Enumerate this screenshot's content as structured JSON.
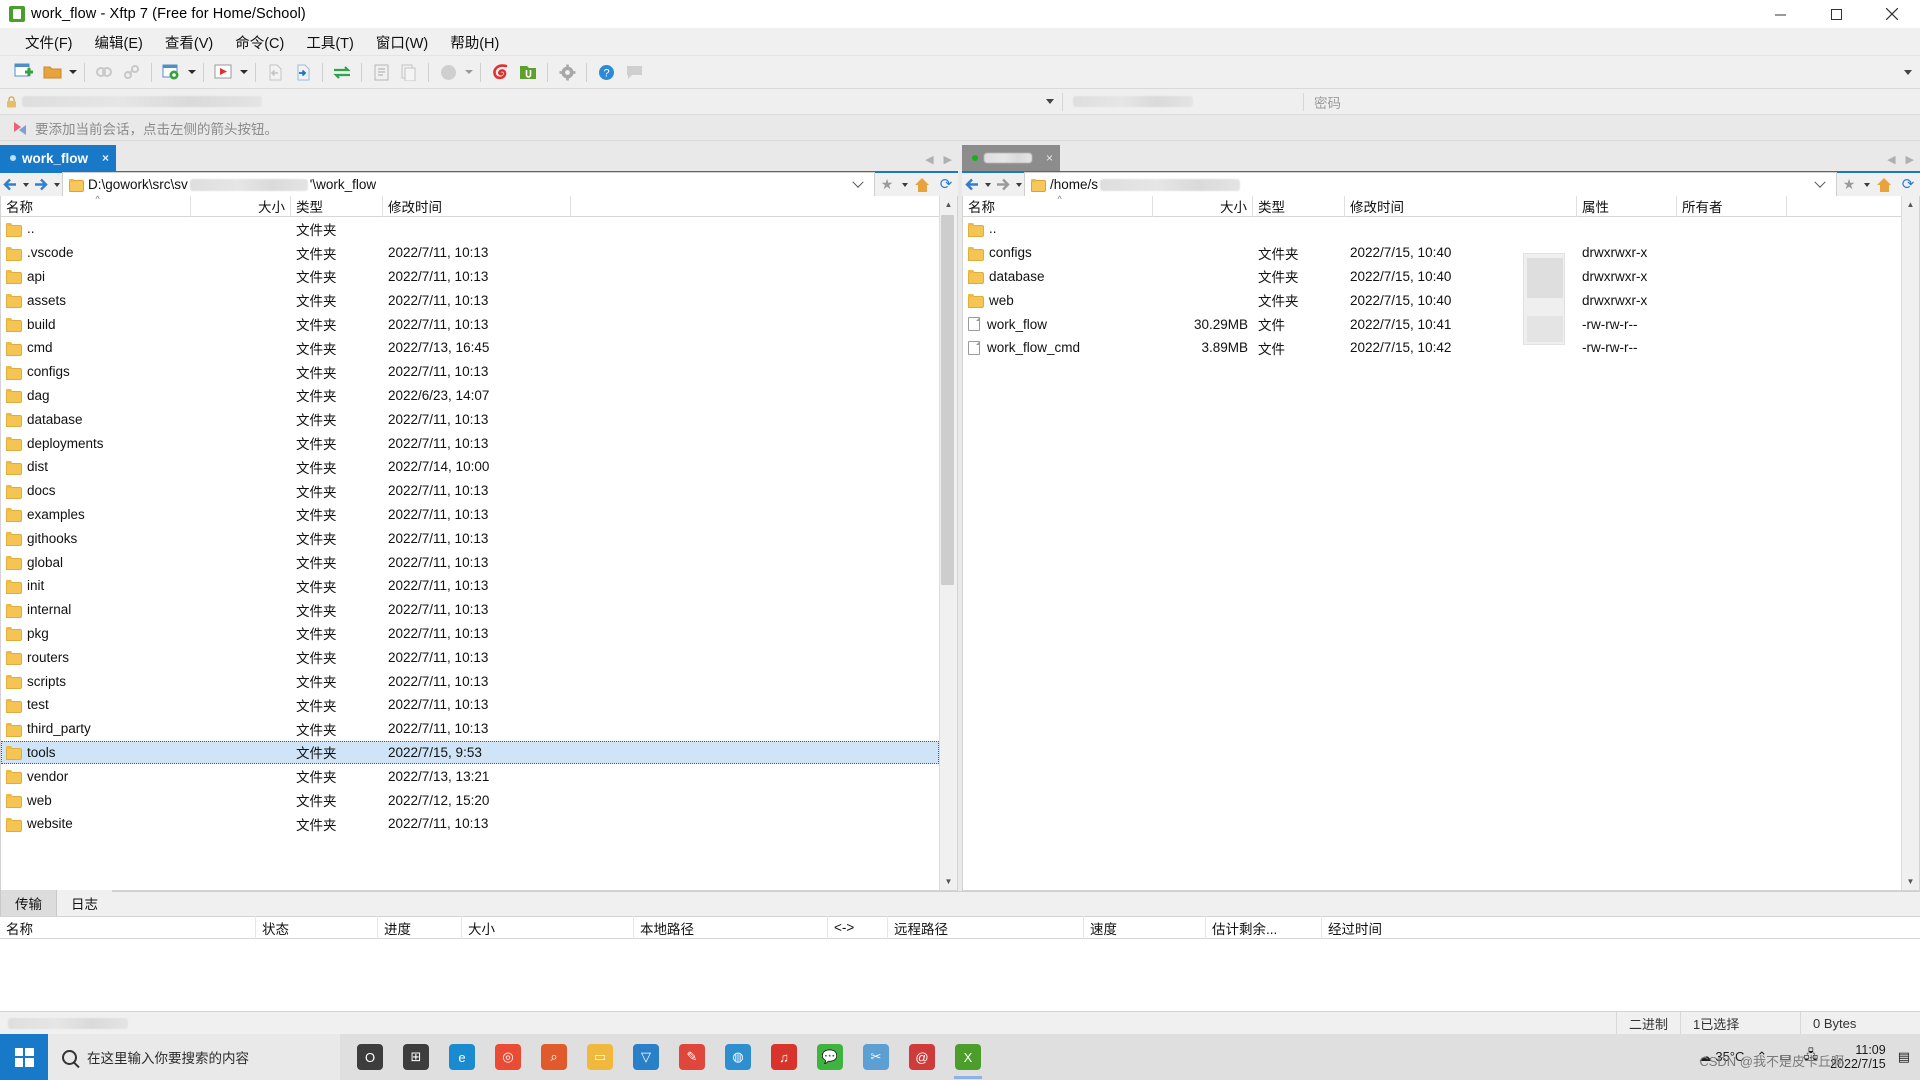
{
  "window": {
    "title": "work_flow - Xftp 7 (Free for Home/School)",
    "app_icon": "xftp-icon",
    "minimize": "minimize-icon",
    "maximize": "maximize-icon",
    "close": "close-icon"
  },
  "menu": {
    "items": [
      {
        "label": "文件(F)",
        "name": "menu-file"
      },
      {
        "label": "编辑(E)",
        "name": "menu-edit"
      },
      {
        "label": "查看(V)",
        "name": "menu-view"
      },
      {
        "label": "命令(C)",
        "name": "menu-command"
      },
      {
        "label": "工具(T)",
        "name": "menu-tools"
      },
      {
        "label": "窗口(W)",
        "name": "menu-window"
      },
      {
        "label": "帮助(H)",
        "name": "menu-help"
      }
    ]
  },
  "toolbar": {
    "overflow_label": "toolbar-overflow"
  },
  "session_bar": {
    "password_label": "密码",
    "lock_icon": "lock-icon"
  },
  "notice": {
    "text": "要添加当前会话，点击左侧的箭头按钮。"
  },
  "left_panel": {
    "tab_label": "work_flow",
    "tab_close": "×",
    "path": "D:\\gowork\\src\\sv",
    "path_suffix": "'\\work_flow",
    "columns": [
      {
        "label": "名称",
        "name": "col-name"
      },
      {
        "label": "大小",
        "name": "col-size"
      },
      {
        "label": "类型",
        "name": "col-type"
      },
      {
        "label": "修改时间",
        "name": "col-modified"
      }
    ],
    "rows": [
      {
        "name": "..",
        "size": "",
        "type": "文件夹",
        "modified": "",
        "icon": "folder-icon",
        "selected": false
      },
      {
        "name": ".vscode",
        "size": "",
        "type": "文件夹",
        "modified": "2022/7/11, 10:13",
        "icon": "folder-icon",
        "selected": false
      },
      {
        "name": "api",
        "size": "",
        "type": "文件夹",
        "modified": "2022/7/11, 10:13",
        "icon": "folder-icon",
        "selected": false
      },
      {
        "name": "assets",
        "size": "",
        "type": "文件夹",
        "modified": "2022/7/11, 10:13",
        "icon": "folder-icon",
        "selected": false
      },
      {
        "name": "build",
        "size": "",
        "type": "文件夹",
        "modified": "2022/7/11, 10:13",
        "icon": "folder-icon",
        "selected": false
      },
      {
        "name": "cmd",
        "size": "",
        "type": "文件夹",
        "modified": "2022/7/13, 16:45",
        "icon": "folder-icon",
        "selected": false
      },
      {
        "name": "configs",
        "size": "",
        "type": "文件夹",
        "modified": "2022/7/11, 10:13",
        "icon": "folder-icon",
        "selected": false
      },
      {
        "name": "dag",
        "size": "",
        "type": "文件夹",
        "modified": "2022/6/23, 14:07",
        "icon": "folder-icon",
        "selected": false
      },
      {
        "name": "database",
        "size": "",
        "type": "文件夹",
        "modified": "2022/7/11, 10:13",
        "icon": "folder-icon",
        "selected": false
      },
      {
        "name": "deployments",
        "size": "",
        "type": "文件夹",
        "modified": "2022/7/11, 10:13",
        "icon": "folder-icon",
        "selected": false
      },
      {
        "name": "dist",
        "size": "",
        "type": "文件夹",
        "modified": "2022/7/14, 10:00",
        "icon": "folder-icon",
        "selected": false
      },
      {
        "name": "docs",
        "size": "",
        "type": "文件夹",
        "modified": "2022/7/11, 10:13",
        "icon": "folder-icon",
        "selected": false
      },
      {
        "name": "examples",
        "size": "",
        "type": "文件夹",
        "modified": "2022/7/11, 10:13",
        "icon": "folder-icon",
        "selected": false
      },
      {
        "name": "githooks",
        "size": "",
        "type": "文件夹",
        "modified": "2022/7/11, 10:13",
        "icon": "folder-icon",
        "selected": false
      },
      {
        "name": "global",
        "size": "",
        "type": "文件夹",
        "modified": "2022/7/11, 10:13",
        "icon": "folder-icon",
        "selected": false
      },
      {
        "name": "init",
        "size": "",
        "type": "文件夹",
        "modified": "2022/7/11, 10:13",
        "icon": "folder-icon",
        "selected": false
      },
      {
        "name": "internal",
        "size": "",
        "type": "文件夹",
        "modified": "2022/7/11, 10:13",
        "icon": "folder-icon",
        "selected": false
      },
      {
        "name": "pkg",
        "size": "",
        "type": "文件夹",
        "modified": "2022/7/11, 10:13",
        "icon": "folder-icon",
        "selected": false
      },
      {
        "name": "routers",
        "size": "",
        "type": "文件夹",
        "modified": "2022/7/11, 10:13",
        "icon": "folder-icon",
        "selected": false
      },
      {
        "name": "scripts",
        "size": "",
        "type": "文件夹",
        "modified": "2022/7/11, 10:13",
        "icon": "folder-icon",
        "selected": false
      },
      {
        "name": "test",
        "size": "",
        "type": "文件夹",
        "modified": "2022/7/11, 10:13",
        "icon": "folder-icon",
        "selected": false
      },
      {
        "name": "third_party",
        "size": "",
        "type": "文件夹",
        "modified": "2022/7/11, 10:13",
        "icon": "folder-icon",
        "selected": false
      },
      {
        "name": "tools",
        "size": "",
        "type": "文件夹",
        "modified": "2022/7/15, 9:53",
        "icon": "folder-icon",
        "selected": true
      },
      {
        "name": "vendor",
        "size": "",
        "type": "文件夹",
        "modified": "2022/7/13, 13:21",
        "icon": "folder-icon",
        "selected": false
      },
      {
        "name": "web",
        "size": "",
        "type": "文件夹",
        "modified": "2022/7/12, 15:20",
        "icon": "folder-icon",
        "selected": false
      },
      {
        "name": "website",
        "size": "",
        "type": "文件夹",
        "modified": "2022/7/11, 10:13",
        "icon": "folder-icon",
        "selected": false
      }
    ]
  },
  "right_panel": {
    "tab_label": "",
    "tab_close": "×",
    "path": "/home/s",
    "columns": [
      {
        "label": "名称",
        "name": "col-name"
      },
      {
        "label": "大小",
        "name": "col-size"
      },
      {
        "label": "类型",
        "name": "col-type"
      },
      {
        "label": "修改时间",
        "name": "col-modified"
      },
      {
        "label": "属性",
        "name": "col-attributes"
      },
      {
        "label": "所有者",
        "name": "col-owner"
      }
    ],
    "rows": [
      {
        "name": "..",
        "size": "",
        "type": "",
        "modified": "",
        "attributes": "",
        "owner": "",
        "icon": "folder-icon"
      },
      {
        "name": "configs",
        "size": "",
        "type": "文件夹",
        "modified": "2022/7/15, 10:40",
        "attributes": "drwxrwxr-x",
        "owner": "",
        "icon": "folder-icon"
      },
      {
        "name": "database",
        "size": "",
        "type": "文件夹",
        "modified": "2022/7/15, 10:40",
        "attributes": "drwxrwxr-x",
        "owner": "",
        "icon": "folder-icon"
      },
      {
        "name": "web",
        "size": "",
        "type": "文件夹",
        "modified": "2022/7/15, 10:40",
        "attributes": "drwxrwxr-x",
        "owner": "",
        "icon": "folder-icon"
      },
      {
        "name": "work_flow",
        "size": "30.29MB",
        "type": "文件",
        "modified": "2022/7/15, 10:41",
        "attributes": "-rw-rw-r--",
        "owner": "",
        "icon": "file-icon"
      },
      {
        "name": "work_flow_cmd",
        "size": "3.89MB",
        "type": "文件",
        "modified": "2022/7/15, 10:42",
        "attributes": "-rw-rw-r--",
        "owner": "",
        "icon": "file-icon"
      }
    ]
  },
  "transfer_panel": {
    "tabs": [
      {
        "label": "传输",
        "name": "tab-transfer",
        "active": true
      },
      {
        "label": "日志",
        "name": "tab-log",
        "active": false
      }
    ],
    "columns": [
      {
        "label": "名称",
        "name": "col-name"
      },
      {
        "label": "状态",
        "name": "col-status"
      },
      {
        "label": "进度",
        "name": "col-progress"
      },
      {
        "label": "大小",
        "name": "col-size"
      },
      {
        "label": "本地路径",
        "name": "col-local-path"
      },
      {
        "label": "<->",
        "name": "col-direction"
      },
      {
        "label": "远程路径",
        "name": "col-remote-path"
      },
      {
        "label": "速度",
        "name": "col-speed"
      },
      {
        "label": "估计剩余...",
        "name": "col-eta"
      },
      {
        "label": "经过时间",
        "name": "col-elapsed"
      }
    ]
  },
  "status_bar": {
    "mode": "二进制",
    "selection": "1已选择",
    "size": "0 Bytes"
  },
  "taskbar": {
    "start": "windows-start-icon",
    "search_placeholder": "在这里输入你要搜索的内容",
    "apps": [
      {
        "name": "taskview-icon",
        "glyph": "O",
        "color": "#3d3d3d"
      },
      {
        "name": "cortana-icon",
        "glyph": "⊞",
        "color": "#3d3d3d"
      },
      {
        "name": "edge-icon",
        "glyph": "e",
        "color": "#1b8bd0"
      },
      {
        "name": "chrome-icon",
        "glyph": "◎",
        "color": "#e94b35"
      },
      {
        "name": "search-icon",
        "glyph": "⌕",
        "color": "#e05a2b"
      },
      {
        "name": "explorer-icon",
        "glyph": "▭",
        "color": "#f0b93e"
      },
      {
        "name": "vscode-icon",
        "glyph": "▽",
        "color": "#2a7fc9"
      },
      {
        "name": "pen-icon",
        "glyph": "✎",
        "color": "#e0473c"
      },
      {
        "name": "navicat-icon",
        "glyph": "◍",
        "color": "#2e8fd0"
      },
      {
        "name": "netease-icon",
        "glyph": "♫",
        "color": "#d9342b"
      },
      {
        "name": "wechat-icon",
        "glyph": "💬",
        "color": "#3fb33f"
      },
      {
        "name": "snipaste-icon",
        "glyph": "✂",
        "color": "#5ca0d3"
      },
      {
        "name": "xshell-icon",
        "glyph": "@",
        "color": "#cf3a3a"
      },
      {
        "name": "xftp-icon",
        "glyph": "X",
        "color": "#4a9e29"
      }
    ],
    "weather_temp": "35°C",
    "weather_icon": "cloud-icon",
    "chevron": "chevron-up-icon",
    "battery": "battery-icon",
    "time": "11:09",
    "date": "2022/7/15",
    "watermark": "CSDN @我不是皮卡丘啊",
    "notification": "notification-icon"
  }
}
